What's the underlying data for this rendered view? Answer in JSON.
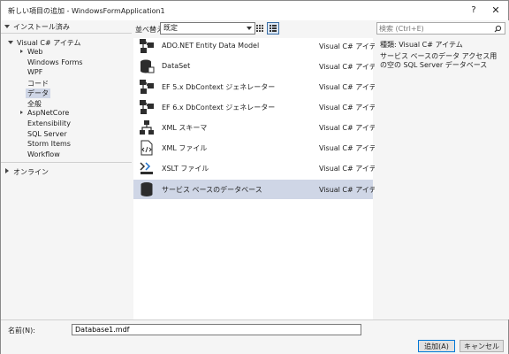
{
  "window": {
    "title": "新しい項目の追加 - WindowsFormApplication1",
    "help_label": "?",
    "close_label": "✕"
  },
  "tree": {
    "header": "インストール済み",
    "root": "Visual C# アイテム",
    "children": [
      "Web",
      "Windows Forms",
      "WPF",
      "コード",
      "データ",
      "全般",
      "AspNetCore",
      "Extensibility",
      "SQL Server",
      "Storm Items",
      "Workflow"
    ],
    "selected": "データ",
    "online": "オンライン"
  },
  "sortbar": {
    "label": "並べ替え:",
    "value": "既定"
  },
  "items": [
    {
      "name": "ADO.NET Entity Data Model",
      "category": "Visual C# アイテム",
      "icon": "entity-model-icon"
    },
    {
      "name": "DataSet",
      "category": "Visual C# アイテム",
      "icon": "dataset-icon"
    },
    {
      "name": "EF 5.x DbContext ジェネレーター",
      "category": "Visual C# アイテム",
      "icon": "ef-generator-icon"
    },
    {
      "name": "EF 6.x DbContext ジェネレーター",
      "category": "Visual C# アイテム",
      "icon": "ef-generator-icon"
    },
    {
      "name": "XML スキーマ",
      "category": "Visual C# アイテム",
      "icon": "xml-schema-icon"
    },
    {
      "name": "XML ファイル",
      "category": "Visual C# アイテム",
      "icon": "xml-file-icon"
    },
    {
      "name": "XSLT ファイル",
      "category": "Visual C# アイテム",
      "icon": "xslt-file-icon"
    },
    {
      "name": "サービス ベースのデータベース",
      "category": "Visual C# アイテム",
      "icon": "database-icon"
    }
  ],
  "selected_index": 7,
  "search": {
    "placeholder": "検索 (Ctrl+E)"
  },
  "details": {
    "type_label": "種類:",
    "type_value": "Visual C# アイテム",
    "description": "サービス ベースのデータ アクセス用の空の SQL Server データベース"
  },
  "bottom": {
    "name_label": "名前(N):",
    "name_value": "Database1.mdf",
    "add_button": "追加(A)",
    "cancel_button": "キャンセル"
  },
  "colors": {
    "selection": "#cfd6e6",
    "accent": "#0078d7",
    "panel": "#f5f5f5"
  }
}
